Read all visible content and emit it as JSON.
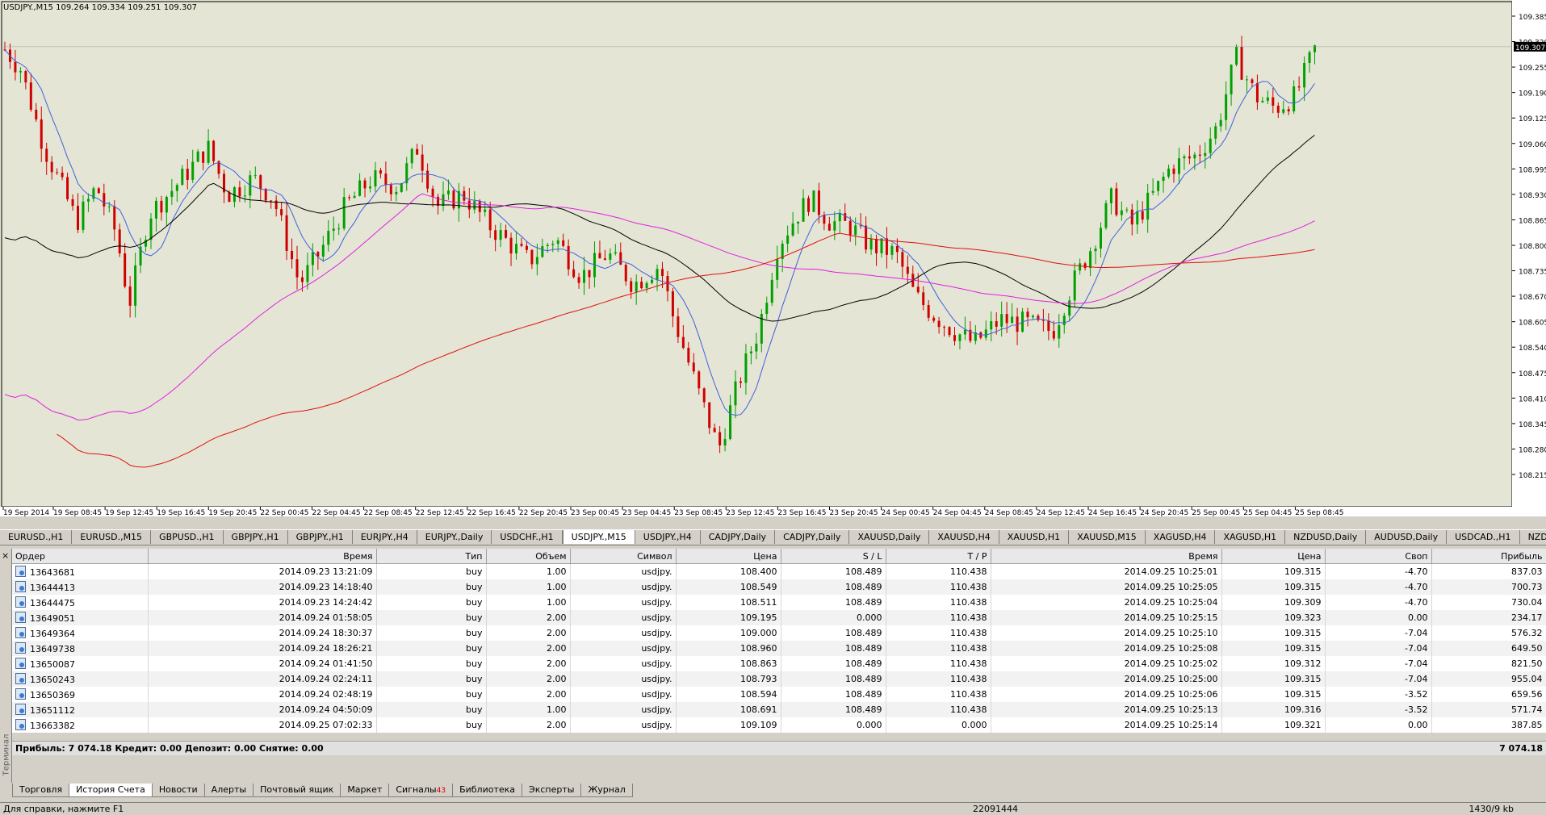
{
  "chart": {
    "title": "USDJPY.,M15  109.264 109.334 109.251 109.307",
    "current_price": "109.307",
    "price_axis": [
      "109.385",
      "109.320",
      "109.255",
      "109.190",
      "109.125",
      "109.060",
      "108.995",
      "108.930",
      "108.865",
      "108.800",
      "108.735",
      "108.670",
      "108.605",
      "108.540",
      "108.475",
      "108.410",
      "108.345",
      "108.280",
      "108.215"
    ],
    "time_axis": [
      "19 Sep 2014",
      "19 Sep 08:45",
      "19 Sep 12:45",
      "19 Sep 16:45",
      "19 Sep 20:45",
      "22 Sep 00:45",
      "22 Sep 04:45",
      "22 Sep 08:45",
      "22 Sep 12:45",
      "22 Sep 16:45",
      "22 Sep 20:45",
      "23 Sep 00:45",
      "23 Sep 04:45",
      "23 Sep 08:45",
      "23 Sep 12:45",
      "23 Sep 16:45",
      "23 Sep 20:45",
      "24 Sep 00:45",
      "24 Sep 04:45",
      "24 Sep 08:45",
      "24 Sep 12:45",
      "24 Sep 16:45",
      "24 Sep 20:45",
      "25 Sep 00:45",
      "25 Sep 04:45",
      "25 Sep 08:45"
    ],
    "colors": {
      "background": "#e4e5d4",
      "bull": "#00a000",
      "bear": "#d00000",
      "ma_fast": "#4060e0",
      "ma_mid": "#000000",
      "ma_slow": "#e020e0",
      "ma_long": "#e01010"
    }
  },
  "symbol_tabs": [
    "EURUSD.,H1",
    "EURUSD.,M15",
    "GBPUSD.,H1",
    "GBPJPY.,H1",
    "GBPJPY.,H1",
    "EURJPY.,H4",
    "EURJPY.,Daily",
    "USDCHF.,H1",
    "USDJPY.,M15",
    "USDJPY.,H4",
    "CADJPY,Daily",
    "CADJPY,Daily",
    "XAUUSD,Daily",
    "XAUUSD,H4",
    "XAUUSD,H1",
    "XAUUSD,M15",
    "XAGUSD,H4",
    "XAGUSD,H1",
    "NZDUSD,Daily",
    "AUDUSD,Daily",
    "USDCAD.,H1",
    "NZDJPY.,Daily"
  ],
  "active_symbol_tab": "USDJPY.,M15",
  "terminal": {
    "side_label": "Терминал",
    "columns": [
      "Ордер",
      "Время",
      "Тип",
      "Объем",
      "Символ",
      "Цена",
      "S / L",
      "T / P",
      "Время",
      "Цена",
      "Своп",
      "Прибыль"
    ],
    "rows": [
      [
        "13643681",
        "2014.09.23 13:21:09",
        "buy",
        "1.00",
        "usdjpy.",
        "108.400",
        "108.489",
        "110.438",
        "2014.09.25 10:25:01",
        "109.315",
        "-4.70",
        "837.03"
      ],
      [
        "13644413",
        "2014.09.23 14:18:40",
        "buy",
        "1.00",
        "usdjpy.",
        "108.549",
        "108.489",
        "110.438",
        "2014.09.25 10:25:05",
        "109.315",
        "-4.70",
        "700.73"
      ],
      [
        "13644475",
        "2014.09.23 14:24:42",
        "buy",
        "1.00",
        "usdjpy.",
        "108.511",
        "108.489",
        "110.438",
        "2014.09.25 10:25:04",
        "109.309",
        "-4.70",
        "730.04"
      ],
      [
        "13649051",
        "2014.09.24 01:58:05",
        "buy",
        "2.00",
        "usdjpy.",
        "109.195",
        "0.000",
        "110.438",
        "2014.09.25 10:25:15",
        "109.323",
        "0.00",
        "234.17"
      ],
      [
        "13649364",
        "2014.09.24 18:30:37",
        "buy",
        "2.00",
        "usdjpy.",
        "109.000",
        "108.489",
        "110.438",
        "2014.09.25 10:25:10",
        "109.315",
        "-7.04",
        "576.32"
      ],
      [
        "13649738",
        "2014.09.24 18:26:21",
        "buy",
        "2.00",
        "usdjpy.",
        "108.960",
        "108.489",
        "110.438",
        "2014.09.25 10:25:08",
        "109.315",
        "-7.04",
        "649.50"
      ],
      [
        "13650087",
        "2014.09.24 01:41:50",
        "buy",
        "2.00",
        "usdjpy.",
        "108.863",
        "108.489",
        "110.438",
        "2014.09.25 10:25:02",
        "109.312",
        "-7.04",
        "821.50"
      ],
      [
        "13650243",
        "2014.09.24 02:24:11",
        "buy",
        "2.00",
        "usdjpy.",
        "108.793",
        "108.489",
        "110.438",
        "2014.09.25 10:25:00",
        "109.315",
        "-7.04",
        "955.04"
      ],
      [
        "13650369",
        "2014.09.24 02:48:19",
        "buy",
        "2.00",
        "usdjpy.",
        "108.594",
        "108.489",
        "110.438",
        "2014.09.25 10:25:06",
        "109.315",
        "-3.52",
        "659.56"
      ],
      [
        "13651112",
        "2014.09.24 04:50:09",
        "buy",
        "1.00",
        "usdjpy.",
        "108.691",
        "108.489",
        "110.438",
        "2014.09.25 10:25:13",
        "109.316",
        "-3.52",
        "571.74"
      ],
      [
        "13663382",
        "2014.09.25 07:02:33",
        "buy",
        "2.00",
        "usdjpy.",
        "109.109",
        "0.000",
        "0.000",
        "2014.09.25 10:25:14",
        "109.321",
        "0.00",
        "387.85"
      ]
    ],
    "summary_left": "Прибыль: 7 074.18  Кредит: 0.00  Депозит: 0.00  Снятие: 0.00",
    "summary_right": "7 074.18"
  },
  "bottom_tabs": [
    {
      "label": "Торговля"
    },
    {
      "label": "История Счета"
    },
    {
      "label": "Новости"
    },
    {
      "label": "Алерты"
    },
    {
      "label": "Почтовый ящик"
    },
    {
      "label": "Маркет"
    },
    {
      "label": "Сигналы",
      "badge": "43"
    },
    {
      "label": "Библиотека"
    },
    {
      "label": "Эксперты"
    },
    {
      "label": "Журнал"
    }
  ],
  "active_bottom_tab": "История Счета",
  "status": {
    "help": "Для справки, нажмите F1",
    "mid": "22091444",
    "right": "1430/9 kb"
  }
}
